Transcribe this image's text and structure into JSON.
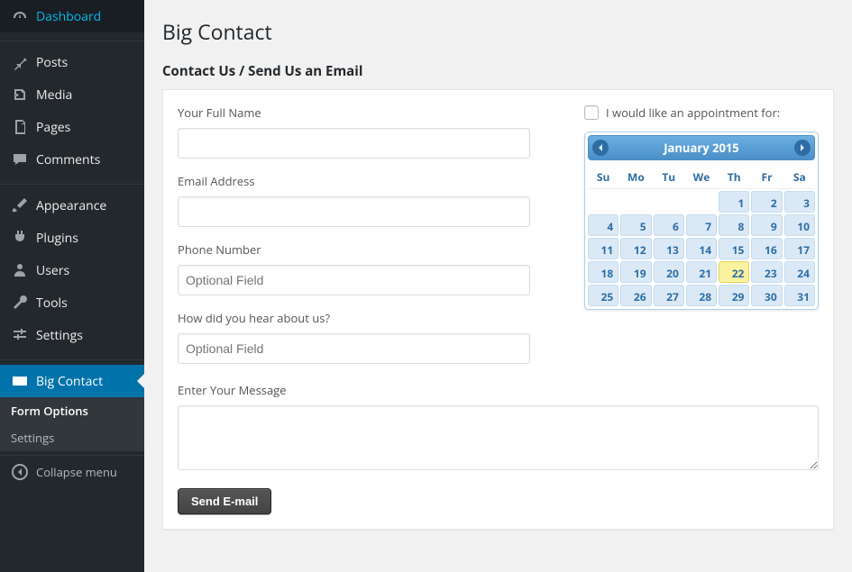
{
  "sidebar": {
    "items": [
      {
        "label": "Dashboard"
      },
      {
        "label": "Posts"
      },
      {
        "label": "Media"
      },
      {
        "label": "Pages"
      },
      {
        "label": "Comments"
      },
      {
        "label": "Appearance"
      },
      {
        "label": "Plugins"
      },
      {
        "label": "Users"
      },
      {
        "label": "Tools"
      },
      {
        "label": "Settings"
      },
      {
        "label": "Big Contact"
      }
    ],
    "submenu": [
      {
        "label": "Form Options",
        "active": true
      },
      {
        "label": "Settings",
        "active": false
      }
    ],
    "collapse": "Collapse menu"
  },
  "page": {
    "title": "Big Contact",
    "subtitle": "Contact Us / Send Us an Email"
  },
  "form": {
    "name_label": "Your Full Name",
    "email_label": "Email Address",
    "phone_label": "Phone Number",
    "phone_placeholder": "Optional Field",
    "hear_label": "How did you hear about us?",
    "hear_placeholder": "Optional Field",
    "message_label": "Enter Your Message",
    "submit_label": "Send E-mail",
    "appointment_label": "I would like an appointment for:"
  },
  "calendar": {
    "title": "January 2015",
    "dow": [
      "Su",
      "Mo",
      "Tu",
      "We",
      "Th",
      "Fr",
      "Sa"
    ],
    "days": [
      null,
      null,
      null,
      null,
      1,
      2,
      3,
      4,
      5,
      6,
      7,
      8,
      9,
      10,
      11,
      12,
      13,
      14,
      15,
      16,
      17,
      18,
      19,
      20,
      21,
      22,
      23,
      24,
      25,
      26,
      27,
      28,
      29,
      30,
      31
    ],
    "today": 22
  }
}
